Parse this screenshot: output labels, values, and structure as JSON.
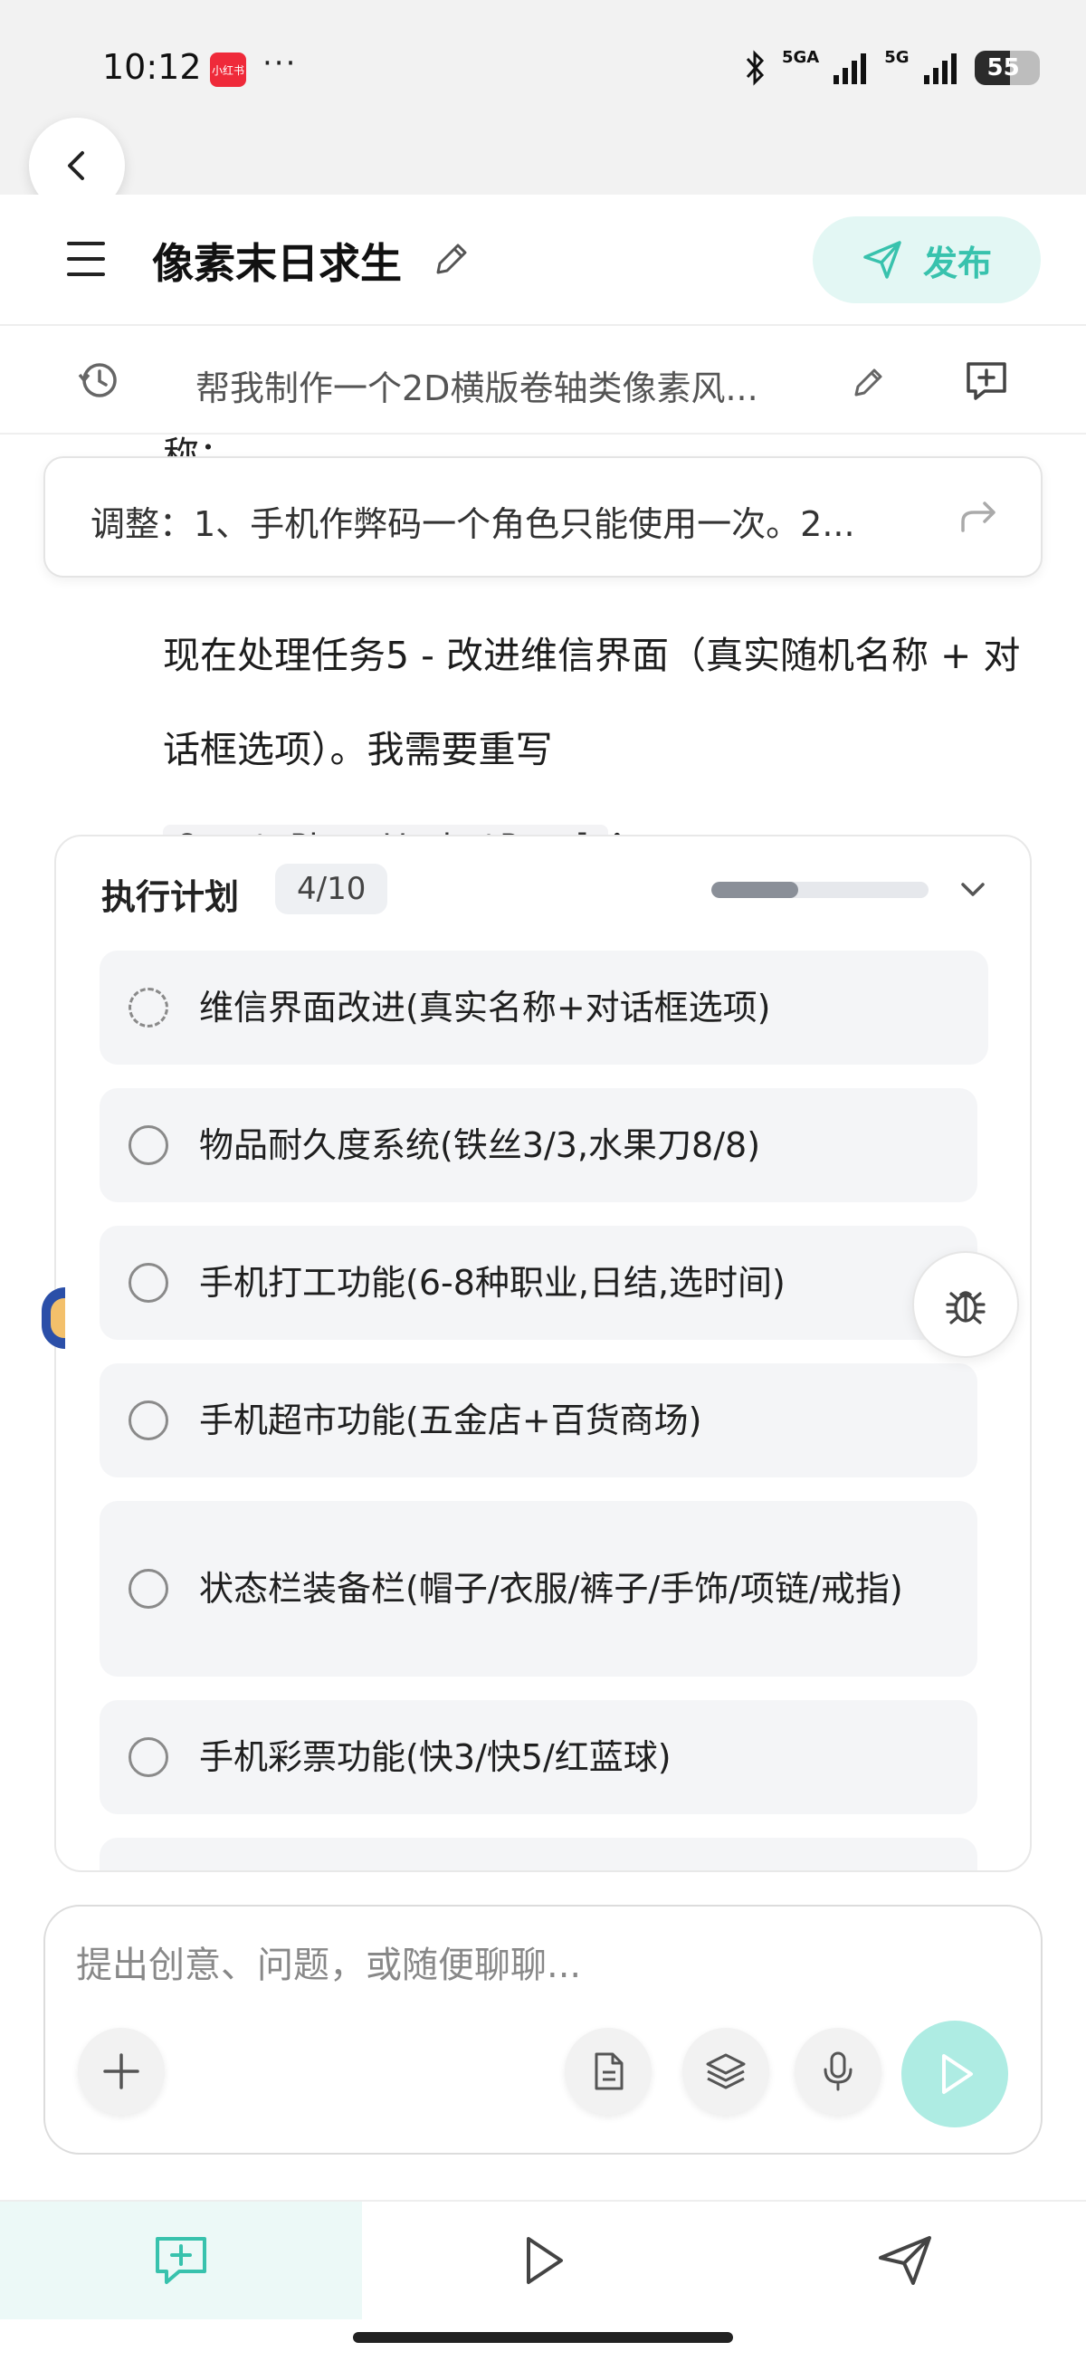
{
  "status_bar": {
    "time": "10:12",
    "app_badge": "小红书",
    "dots": "···",
    "network_1": "5GA",
    "network_2": "5G",
    "battery": "55"
  },
  "header": {
    "title": "像素末日求生",
    "publish_label": "发布"
  },
  "task": {
    "prompt": "帮我制作一个2D横版卷轴类像素风..."
  },
  "chat": {
    "cut_off_text": "称：",
    "adjust_card_text": "调整：1、手机作弊码一个角色只能使用一次。2...",
    "message_text": "现在处理任务5 - 改进维信界面（真实随机名称 + 对话框选项）。我需要重写",
    "message_code": "CreatePhoneWechatPanel",
    "message_suffix": "："
  },
  "plan": {
    "title": "执行计划",
    "count": "4/10",
    "progress": 0.4,
    "items": [
      {
        "label": "维信界面改进(真实名称+对话框选项)",
        "status": "in-progress"
      },
      {
        "label": "物品耐久度系统(铁丝3/3,水果刀8/8)",
        "status": "pending"
      },
      {
        "label": "手机打工功能(6-8种职业,日结,选时间)",
        "status": "pending"
      },
      {
        "label": "手机超市功能(五金店+百货商场)",
        "status": "pending"
      },
      {
        "label": "状态栏装备栏(帽子/衣服/裤子/手饰/项链/戒指)",
        "status": "pending"
      },
      {
        "label": "手机彩票功能(快3/快5/红蓝球)",
        "status": "pending"
      }
    ]
  },
  "composer": {
    "placeholder": "提出创意、问题，或随便聊聊..."
  },
  "colors": {
    "accent": "#38c2ad",
    "accent_light": "#e3f7f4",
    "send_disabled": "#aeece3"
  }
}
